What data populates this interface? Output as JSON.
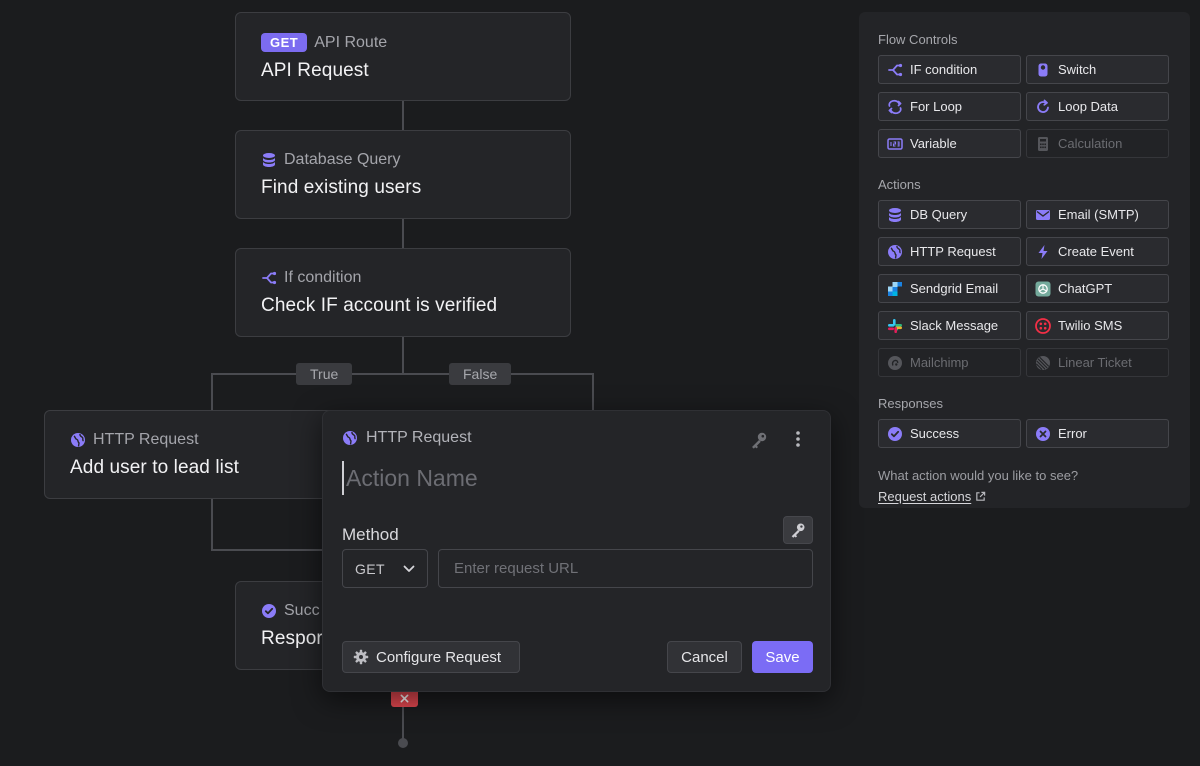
{
  "flow": {
    "nodes": [
      {
        "id": "api-request",
        "badge": "GET",
        "subtitle": "API Route",
        "title": "API Request",
        "icon": "get-badge"
      },
      {
        "id": "database-query",
        "subtitle": "Database Query",
        "title": "Find existing users",
        "icon": "database-icon"
      },
      {
        "id": "if-condition",
        "subtitle": "If condition",
        "title": "Check IF account is verified",
        "icon": "branch-icon"
      },
      {
        "id": "http-request",
        "subtitle": "HTTP Request",
        "title": "Add user to lead list",
        "icon": "globe-icon"
      },
      {
        "id": "success",
        "subtitle": "Succ",
        "title": "Respor",
        "icon": "check-circle-icon"
      }
    ],
    "branches": {
      "true_label": "True",
      "false_label": "False"
    }
  },
  "modal": {
    "header": "HTTP Request",
    "action_name_placeholder": "Action Name",
    "method_label": "Method",
    "method_value": "GET",
    "url_placeholder": "Enter request URL",
    "configure_label": "Configure Request",
    "cancel_label": "Cancel",
    "save_label": "Save"
  },
  "panel": {
    "sections": [
      {
        "title": "Flow Controls",
        "items": [
          {
            "label": "IF condition",
            "icon": "branch-icon",
            "disabled": false
          },
          {
            "label": "Switch",
            "icon": "switch-icon",
            "disabled": false
          },
          {
            "label": "For Loop",
            "icon": "loop-icon",
            "disabled": false
          },
          {
            "label": "Loop Data",
            "icon": "refresh-icon",
            "disabled": false
          },
          {
            "label": "Variable",
            "icon": "variable-icon",
            "disabled": false
          },
          {
            "label": "Calculation",
            "icon": "calculator-icon",
            "disabled": true
          }
        ]
      },
      {
        "title": "Actions",
        "items": [
          {
            "label": "DB Query",
            "icon": "database-icon",
            "disabled": false
          },
          {
            "label": "Email (SMTP)",
            "icon": "mail-icon",
            "disabled": false
          },
          {
            "label": "HTTP Request",
            "icon": "globe-icon",
            "disabled": false
          },
          {
            "label": "Create Event",
            "icon": "bolt-icon",
            "disabled": false
          },
          {
            "label": "Sendgrid Email",
            "icon": "sendgrid-icon",
            "disabled": false
          },
          {
            "label": "ChatGPT",
            "icon": "chatgpt-icon",
            "disabled": false
          },
          {
            "label": "Slack Message",
            "icon": "slack-icon",
            "disabled": false
          },
          {
            "label": "Twilio SMS",
            "icon": "twilio-icon",
            "disabled": false
          },
          {
            "label": "Mailchimp",
            "icon": "mailchimp-icon",
            "disabled": true
          },
          {
            "label": "Linear Ticket",
            "icon": "linear-icon",
            "disabled": true
          }
        ]
      },
      {
        "title": "Responses",
        "items": [
          {
            "label": "Success",
            "icon": "check-circle-icon",
            "disabled": false
          },
          {
            "label": "Error",
            "icon": "error-circle-icon",
            "disabled": false
          }
        ]
      }
    ],
    "prompt": "What action would you like to see?",
    "link_label": "Request actions"
  },
  "colors": {
    "accent": "#7b6cf5",
    "background": "#1b1c1e",
    "node": "#242528",
    "error": "#e34850"
  }
}
